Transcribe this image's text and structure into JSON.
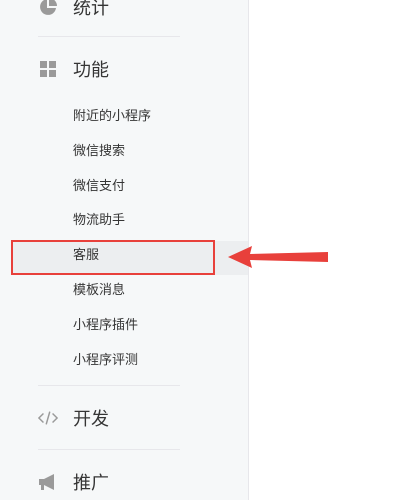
{
  "sidebar": {
    "sections": {
      "stats": {
        "label": "统计",
        "icon": "pie-chart-icon"
      },
      "features": {
        "label": "功能",
        "icon": "grid-icon"
      },
      "develop": {
        "label": "开发",
        "icon": "code-icon"
      },
      "promote": {
        "label": "推广",
        "icon": "megaphone-icon"
      }
    },
    "feature_items": [
      {
        "label": "附近的小程序"
      },
      {
        "label": "微信搜索"
      },
      {
        "label": "微信支付"
      },
      {
        "label": "物流助手"
      },
      {
        "label": "客服"
      },
      {
        "label": "模板消息"
      },
      {
        "label": "小程序插件"
      },
      {
        "label": "小程序评测"
      }
    ]
  },
  "annotation": {
    "color": "#e8403b",
    "icon": "red-arrow-left-icon"
  }
}
